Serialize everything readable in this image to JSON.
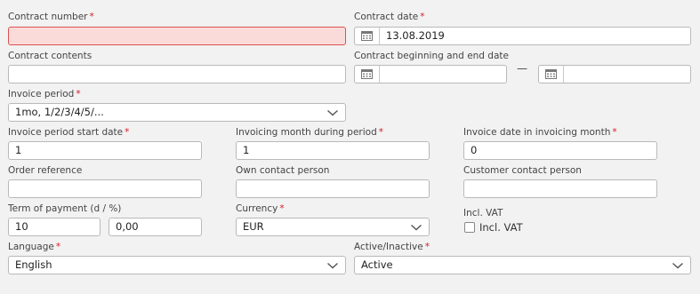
{
  "fields": {
    "contract_number": {
      "label": "Contract number",
      "required": true,
      "value": ""
    },
    "contract_date": {
      "label": "Contract date",
      "required": true,
      "value": "13.08.2019"
    },
    "contract_contents": {
      "label": "Contract contents",
      "value": ""
    },
    "contract_period": {
      "label": "Contract beginning and end date",
      "start": "",
      "end": "",
      "separator": "—"
    },
    "invoice_period": {
      "label": "Invoice period",
      "required": true,
      "value": "1mo, 1/2/3/4/5/..."
    },
    "invoice_period_start_date": {
      "label": "Invoice period start date",
      "required": true,
      "value": "1"
    },
    "invoicing_month": {
      "label": "Invoicing month during period",
      "required": true,
      "value": "1"
    },
    "invoice_date": {
      "label": "Invoice date in invoicing month",
      "required": true,
      "value": "0"
    },
    "order_reference": {
      "label": "Order reference",
      "value": ""
    },
    "own_contact": {
      "label": "Own contact person",
      "value": ""
    },
    "customer_contact": {
      "label": "Customer contact person",
      "value": ""
    },
    "term_of_payment": {
      "label": "Term of payment (d / %)",
      "days": "10",
      "percent": "0,00"
    },
    "currency": {
      "label": "Currency",
      "required": true,
      "value": "EUR"
    },
    "incl_vat": {
      "label": "Incl. VAT",
      "checkbox_label": "Incl. VAT",
      "checked": false
    },
    "language": {
      "label": "Language",
      "required": true,
      "value": "English"
    },
    "active_inactive": {
      "label": "Active/Inactive",
      "required": true,
      "value": "Active"
    }
  },
  "required_marker": "*",
  "icons": {
    "calendar": "calendar-icon",
    "dropdown": "chevron-down-icon"
  },
  "colors": {
    "required": "#d0212a",
    "error_bg": "#fbdada",
    "error_border": "#d9534f"
  }
}
